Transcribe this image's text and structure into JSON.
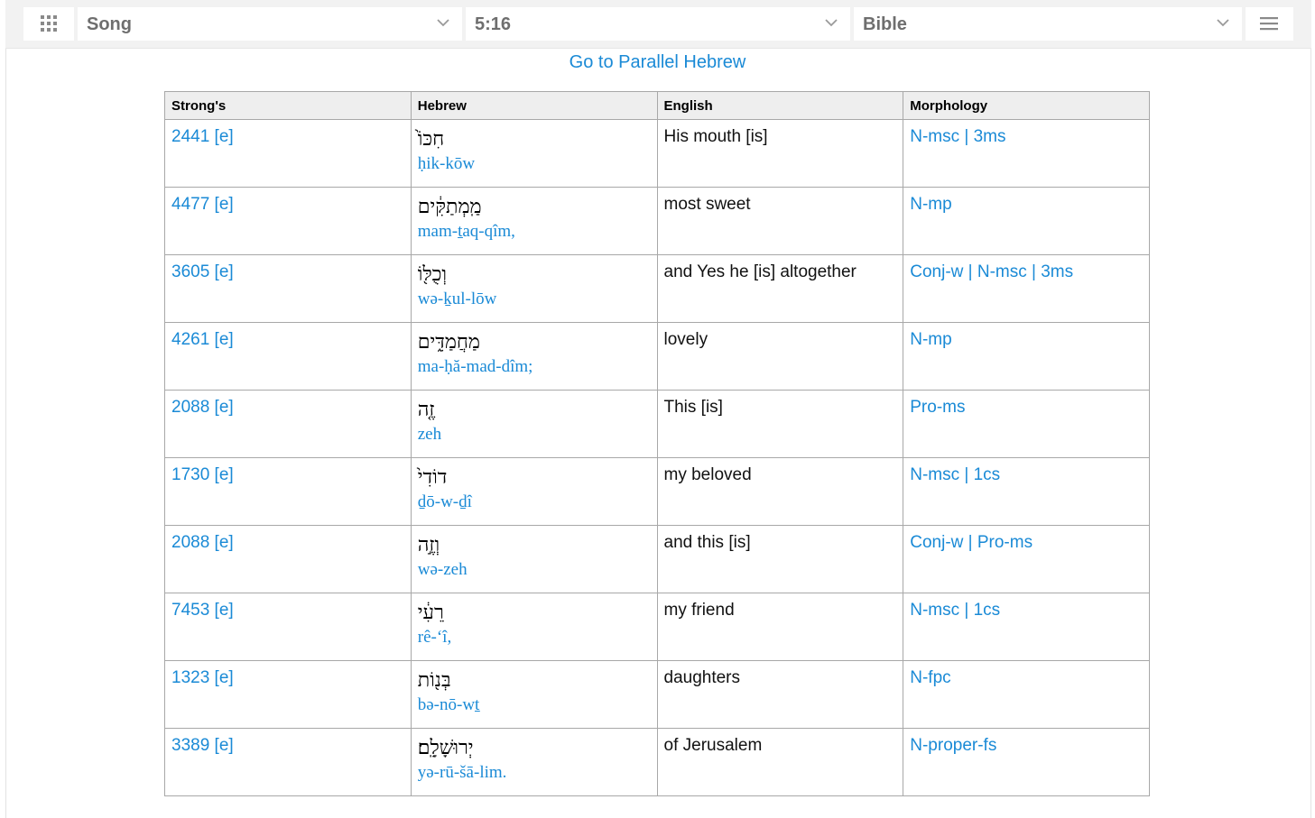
{
  "toolbar": {
    "grid_icon": "grid-icon",
    "book": "Song",
    "chapter_verse": "5:16",
    "version": "Bible",
    "menu_icon": "hamburger-menu-icon"
  },
  "parallel_link": "Go to Parallel Hebrew",
  "table": {
    "headers": [
      "Strong's",
      "Hebrew",
      "English",
      "Morphology"
    ],
    "rows": [
      {
        "strongs": "2441 [e]",
        "hebrew": "חִכּוֹ֙",
        "translit": "ḥik-kōw",
        "english": "His mouth [is]",
        "morph": "N-msc | 3ms"
      },
      {
        "strongs": "4477 [e]",
        "hebrew": "מַֽמְתַקִּ֔ים",
        "translit": "mam-ṯaq-qîm,",
        "english": "most sweet",
        "morph": "N-mp"
      },
      {
        "strongs": "3605 [e]",
        "hebrew": "וְכֻלּ֖וֹ",
        "translit": "wə-ḵul-lōw",
        "english": "and Yes he [is] altogether",
        "morph": "Conj-w | N-msc | 3ms"
      },
      {
        "strongs": "4261 [e]",
        "hebrew": "מַחֲמַדִּ֑ים",
        "translit": "ma-ḥă-mad-dîm;",
        "english": "lovely",
        "morph": "N-mp"
      },
      {
        "strongs": "2088 [e]",
        "hebrew": "זֶ֤ה",
        "translit": "zeh",
        "english": "This [is]",
        "morph": "Pro-ms"
      },
      {
        "strongs": "1730 [e]",
        "hebrew": "דוֹדִי֙",
        "translit": "ḏō-w-ḏî",
        "english": "my beloved",
        "morph": "N-msc | 1cs"
      },
      {
        "strongs": "2088 [e]",
        "hebrew": "וְזֶ֣ה",
        "translit": "wə-zeh",
        "english": "and this [is]",
        "morph": "Conj-w | Pro-ms"
      },
      {
        "strongs": "7453 [e]",
        "hebrew": "רֵעִ֔י",
        "translit": "rê-‘î,",
        "english": "my friend",
        "morph": "N-msc | 1cs"
      },
      {
        "strongs": "1323 [e]",
        "hebrew": "בְּנ֖וֹת",
        "translit": "bə-nō-wṯ",
        "english": "daughters",
        "morph": "N-fpc"
      },
      {
        "strongs": "3389 [e]",
        "hebrew": "יְרוּשָׁלִָֽם׃",
        "translit": "yə-rū-šā-lim.",
        "english": "of Jerusalem",
        "morph": "N-proper-fs"
      }
    ]
  }
}
